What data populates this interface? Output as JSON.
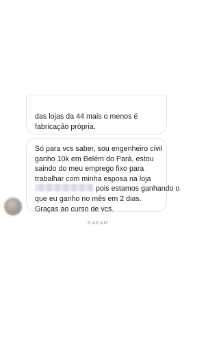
{
  "messages": [
    {
      "lines": [
        "das lojas da 44 mais o menos é",
        "fabricação própria."
      ]
    },
    {
      "lines": [
        "Só para vcs saber, sou engenheiro civil",
        "ganho 10k em Belém do Pará, estou",
        "saindo do meu emprego fixo para",
        "trabalhar com minha esposa na loja",
        "pois estamos ganhando o",
        "que eu ganho no mês  em 2 dias.",
        "Graças ao curso de vcs."
      ]
    }
  ],
  "timestamp": "6:43 AM",
  "colors": {
    "bubble_border": "#e3e3e3",
    "text": "#1c1c1c",
    "timestamp": "#9a9a9a"
  }
}
